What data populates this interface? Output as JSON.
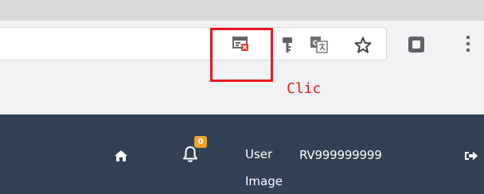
{
  "browser_toolbar": {
    "icons": {
      "popup_blocked": "popup-blocked-icon",
      "key": "key-icon",
      "translate": "translate-icon",
      "bookmark": "star-icon",
      "extension": "extension-icon",
      "menu": "kebab-menu-icon"
    }
  },
  "annotation": {
    "label": "Clic",
    "color": "#e8161a"
  },
  "navbar": {
    "notification_count": "0",
    "user_label_line1": "User",
    "user_label_line2": "Image",
    "user_id": "RV999999999",
    "background": "#2f4153",
    "badge_color": "#f0a128"
  }
}
